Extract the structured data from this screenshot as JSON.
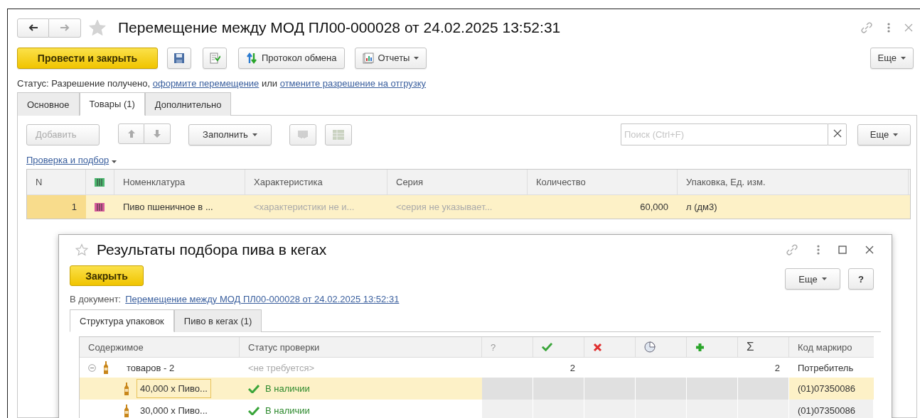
{
  "window": {
    "title": "Перемещение между МОД ПЛ00-000028 от 24.02.2025 13:52:31",
    "starred": false
  },
  "toolbar": {
    "primary": "Провести и закрыть",
    "exchange": "Протокол обмена",
    "reports": "Отчеты",
    "more": "Еще"
  },
  "status_line": [
    {
      "kind": "text",
      "text": "Статус: Разрешение получено,"
    },
    {
      "kind": "link",
      "text": "оформите перемещение"
    },
    {
      "kind": "text",
      "text": "или"
    },
    {
      "kind": "link",
      "text": "отмените разрешение на отгрузку"
    }
  ],
  "tabs": [
    {
      "label": "Основное",
      "selected": false
    },
    {
      "label": "Товары (1)",
      "selected": true
    },
    {
      "label": "Дополнительно",
      "selected": false
    }
  ],
  "goods_toolbar": {
    "add": {
      "label": "Добавить",
      "disabled": true
    },
    "fill": "Заполнить",
    "search": {
      "placeholder": "Поиск (Ctrl+F)"
    },
    "more": "Еще"
  },
  "check_link": "Проверка и подбор",
  "table": {
    "columns": [
      "N",
      "Номенклатура",
      "Характеристика",
      "Серия",
      "Количество",
      "Упаковка, Ед. изм."
    ],
    "rows": [
      {
        "n": "1",
        "nomenclature": "Пиво пшеничное в ...",
        "characteristic": "<характеристики не и...",
        "series": "<серия не указывает...",
        "quantity": "60,000",
        "unit": "л (дм3)",
        "selected": true
      }
    ]
  },
  "dialog": {
    "title": "Результаты подбора пива в кегах",
    "starred": false,
    "close": "Закрыть",
    "more": "Еще",
    "help": "?",
    "document_label": "В документ:",
    "document_link": "Перемещение между МОД ПЛ00-000028 от 24.02.2025 13:52:31",
    "tabs": [
      {
        "label": "Структура упаковок",
        "selected": true
      },
      {
        "label": "Пиво в кегах (1)",
        "selected": false
      }
    ],
    "columns": {
      "content": "Содержимое",
      "status": "Статус проверки",
      "unknown": "?",
      "total": "Σ",
      "code": "Код маркиро"
    },
    "tree": [
      {
        "content": "товаров - 2",
        "status": "<не требуется>",
        "kind": "group",
        "checked_count": "2",
        "total": "2",
        "code": "Потребитель",
        "expanded": true,
        "selected": false,
        "children": [
          {
            "content": "40,000 x Пиво...",
            "status": "В наличии",
            "kind": "item",
            "code": "(01)07350086",
            "selected": true
          },
          {
            "content": "30,000 x Пиво...",
            "status": "В наличии",
            "kind": "item",
            "code": "(01)07350086",
            "selected": false
          }
        ]
      }
    ]
  }
}
